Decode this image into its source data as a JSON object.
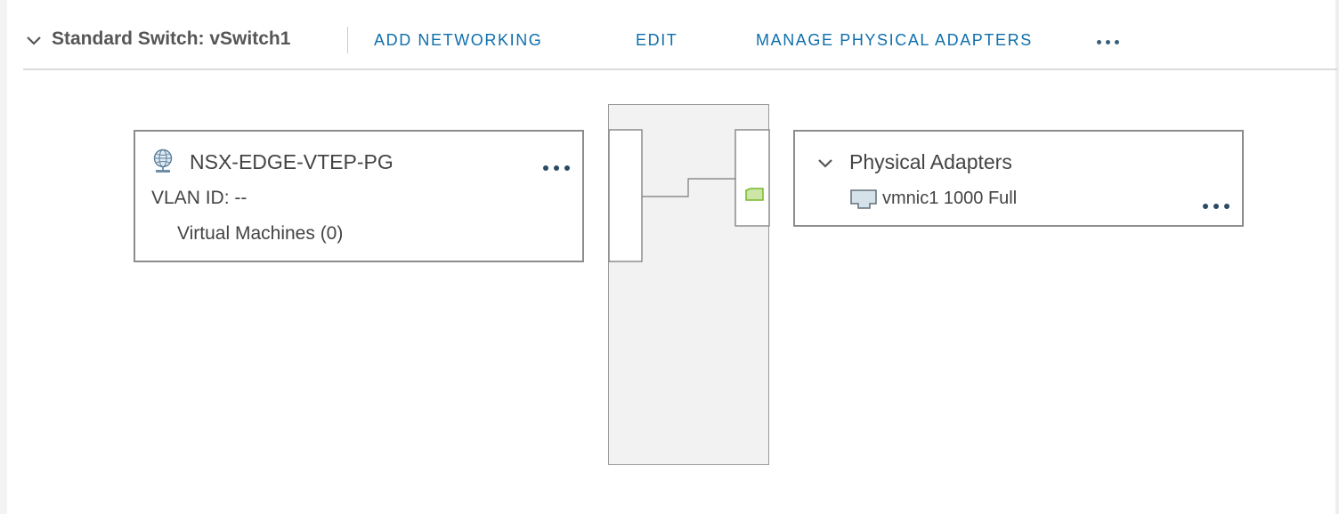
{
  "header": {
    "collapse_icon": "chevron-down-icon",
    "switch_title": "Standard Switch: vSwitch1",
    "actions": {
      "add_networking": "ADD NETWORKING",
      "edit": "EDIT",
      "manage_physical_adapters": "MANAGE PHYSICAL ADAPTERS",
      "more_icon": "more-horizontal-icon"
    }
  },
  "port_group": {
    "icon": "port-group-globe-icon",
    "name": "NSX-EDGE-VTEP-PG",
    "vlan_id": "VLAN ID: --",
    "virtual_machines": "Virtual Machines (0)",
    "more_icon": "more-horizontal-icon"
  },
  "switch_diagram": {
    "uplink_port_color": "#cde6a7",
    "uplink_port_border": "#76b82a"
  },
  "physical_adapters": {
    "collapse_icon": "chevron-down-icon",
    "title": "Physical Adapters",
    "nics": [
      {
        "icon": "network-adapter-icon",
        "label": "vmnic1 1000 Full"
      }
    ],
    "more_icon": "more-horizontal-icon"
  },
  "colors": {
    "link": "#0f6fab",
    "border": "#8c8c8c",
    "switch_fill": "#f2f2f2"
  }
}
